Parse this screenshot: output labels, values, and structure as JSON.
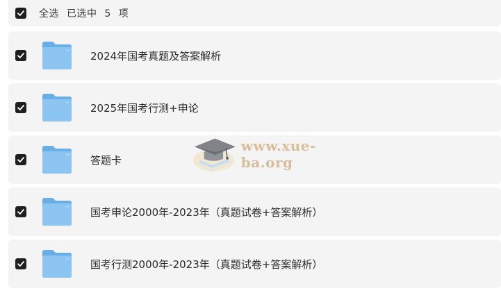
{
  "header": {
    "select_all": "全选",
    "selected_prefix": "已选中",
    "selected_count": "5",
    "selected_unit": "项"
  },
  "items": [
    {
      "name": "2024年国考真题及答案解析",
      "type": "folder",
      "checked": true
    },
    {
      "name": "2025年国考行测+申论",
      "type": "folder",
      "checked": true
    },
    {
      "name": "答题卡",
      "type": "folder",
      "checked": true
    },
    {
      "name": "国考申论2000年-2023年（真题试卷+答案解析）",
      "type": "folder",
      "checked": true
    },
    {
      "name": "国考行测2000年-2023年（真题试卷+答案解析）",
      "type": "folder",
      "checked": true
    }
  ],
  "watermark": {
    "text": "www.xue-ba.org"
  },
  "colors": {
    "row_bg": "#f4f4f5",
    "checkbox": "#1f1f1f",
    "folder_back": "#6aaee8",
    "folder_front": "#8cc4f2",
    "watermark": "#d4b48a"
  },
  "icons": {
    "checkbox": "checkmark-icon",
    "item": "folder-icon",
    "watermark_logo": "graduation-cap-icon"
  }
}
